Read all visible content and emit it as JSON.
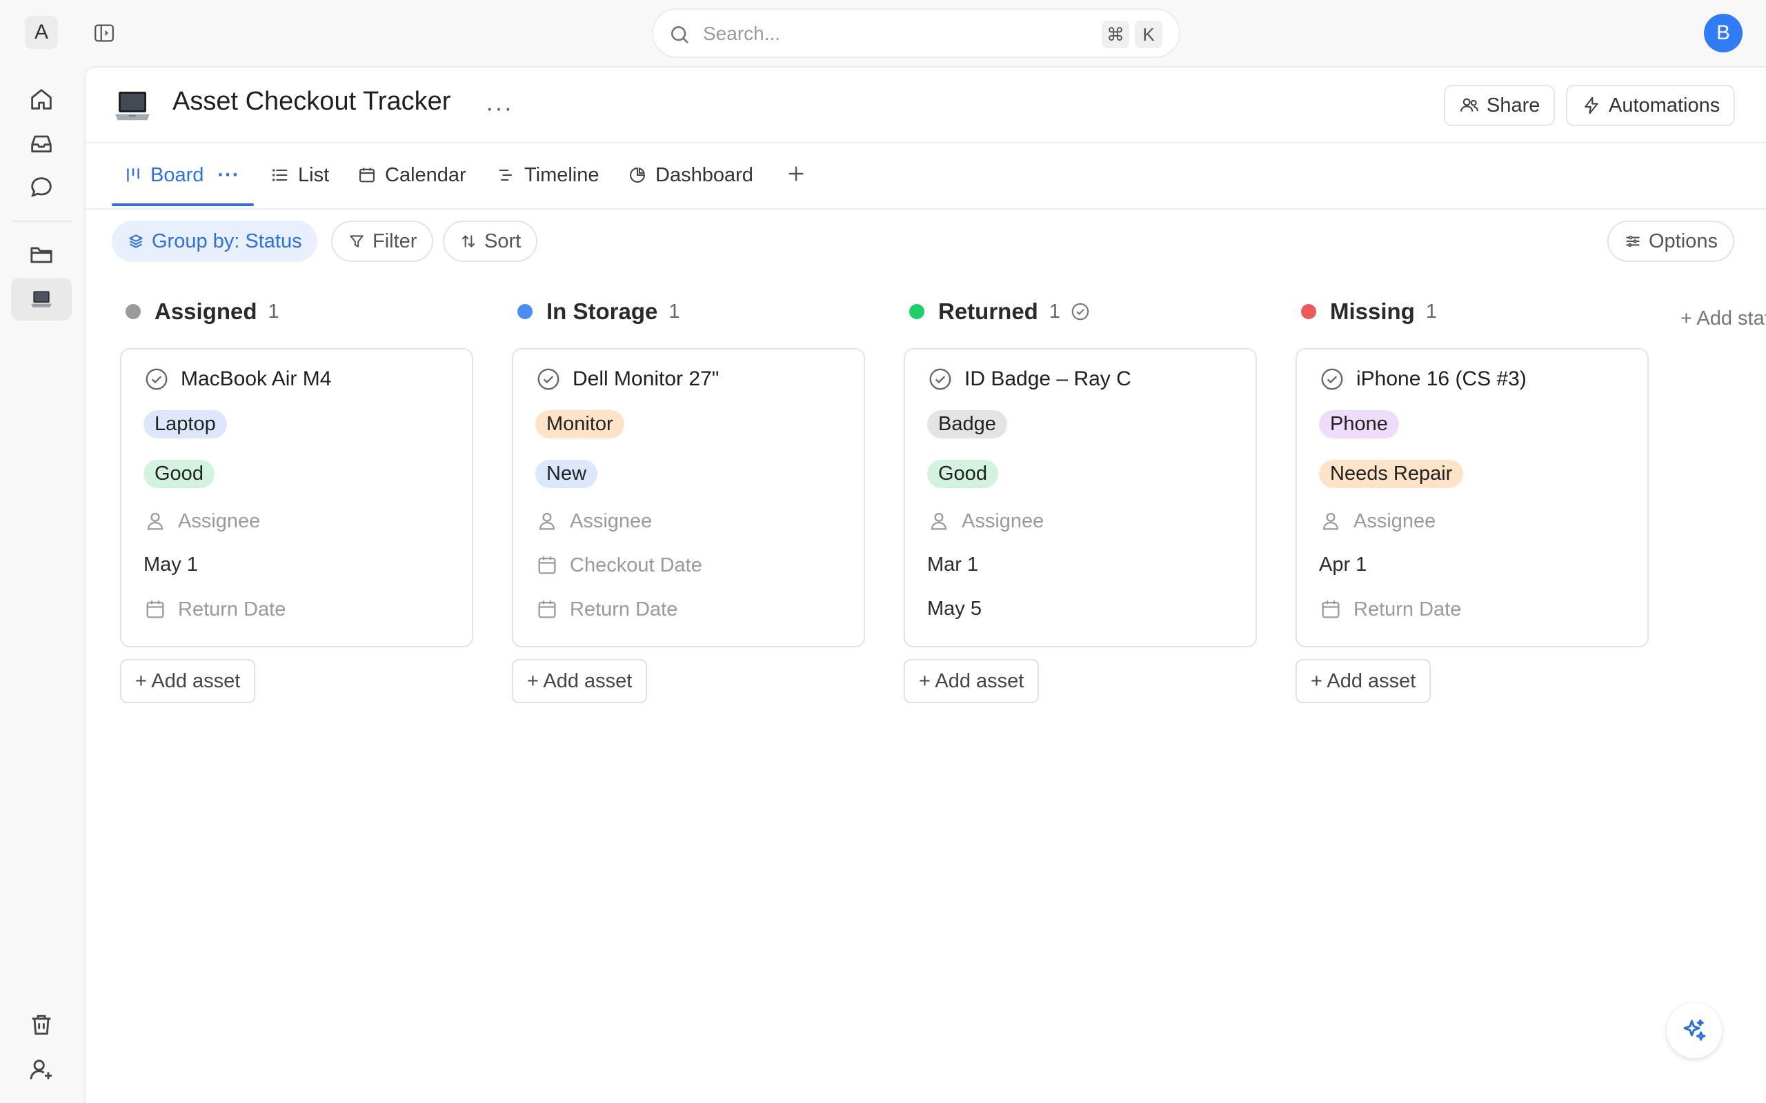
{
  "topbar": {
    "workspace_initial": "A",
    "search_placeholder": "Search...",
    "shortcut_cmd": "⌘",
    "shortcut_key": "K",
    "avatar_initial": "B",
    "avatar_color": "#2f7cf6"
  },
  "page": {
    "icon": "laptop-icon",
    "title": "Asset Checkout Tracker",
    "more": "···",
    "share_label": "Share",
    "automations_label": "Automations"
  },
  "tabs": [
    {
      "label": "Board",
      "icon": "board-icon",
      "active": true
    },
    {
      "label": "List",
      "icon": "list-icon"
    },
    {
      "label": "Calendar",
      "icon": "calendar-icon"
    },
    {
      "label": "Timeline",
      "icon": "timeline-icon"
    },
    {
      "label": "Dashboard",
      "icon": "dashboard-icon"
    }
  ],
  "tab_more": "···",
  "toolbar": {
    "group_by": "Group by: Status",
    "filter": "Filter",
    "sort": "Sort",
    "options": "Options"
  },
  "columns": [
    {
      "name": "Assigned",
      "count": "1",
      "color": "#9a9a9a",
      "card": {
        "name": "MacBook Air M4",
        "type": {
          "label": "Laptop",
          "bg": "#dce7fb"
        },
        "condition": {
          "label": "Good",
          "bg": "#d3f2df"
        },
        "assignee": "Assignee",
        "checkout": "May 1",
        "return": "Return Date"
      }
    },
    {
      "name": "In Storage",
      "count": "1",
      "color": "#4a8ef5",
      "card": {
        "name": "Dell Monitor 27\"",
        "type": {
          "label": "Monitor",
          "bg": "#fde3c7"
        },
        "condition": {
          "label": "New",
          "bg": "#dce7fb"
        },
        "assignee": "Assignee",
        "checkout": "Checkout Date",
        "return": "Return Date"
      }
    },
    {
      "name": "Returned",
      "count": "1",
      "color": "#1fcf6a",
      "card": {
        "name": "ID Badge – Ray C",
        "type": {
          "label": "Badge",
          "bg": "#e4e4e4"
        },
        "condition": {
          "label": "Good",
          "bg": "#d3f2df"
        },
        "assignee": "Assignee",
        "checkout": "Mar 1",
        "return": "May 5"
      }
    },
    {
      "name": "Missing",
      "count": "1",
      "color": "#ee5a5a",
      "card": {
        "name": "iPhone 16 (CS #3)",
        "type": {
          "label": "Phone",
          "bg": "#efdcfb"
        },
        "condition": {
          "label": "Needs Repair",
          "bg": "#fde3c7"
        },
        "assignee": "Assignee",
        "checkout": "Apr 1",
        "return": "Return Date"
      }
    }
  ],
  "add_asset_label": "+ Add asset",
  "add_status_label": "+ Add status"
}
